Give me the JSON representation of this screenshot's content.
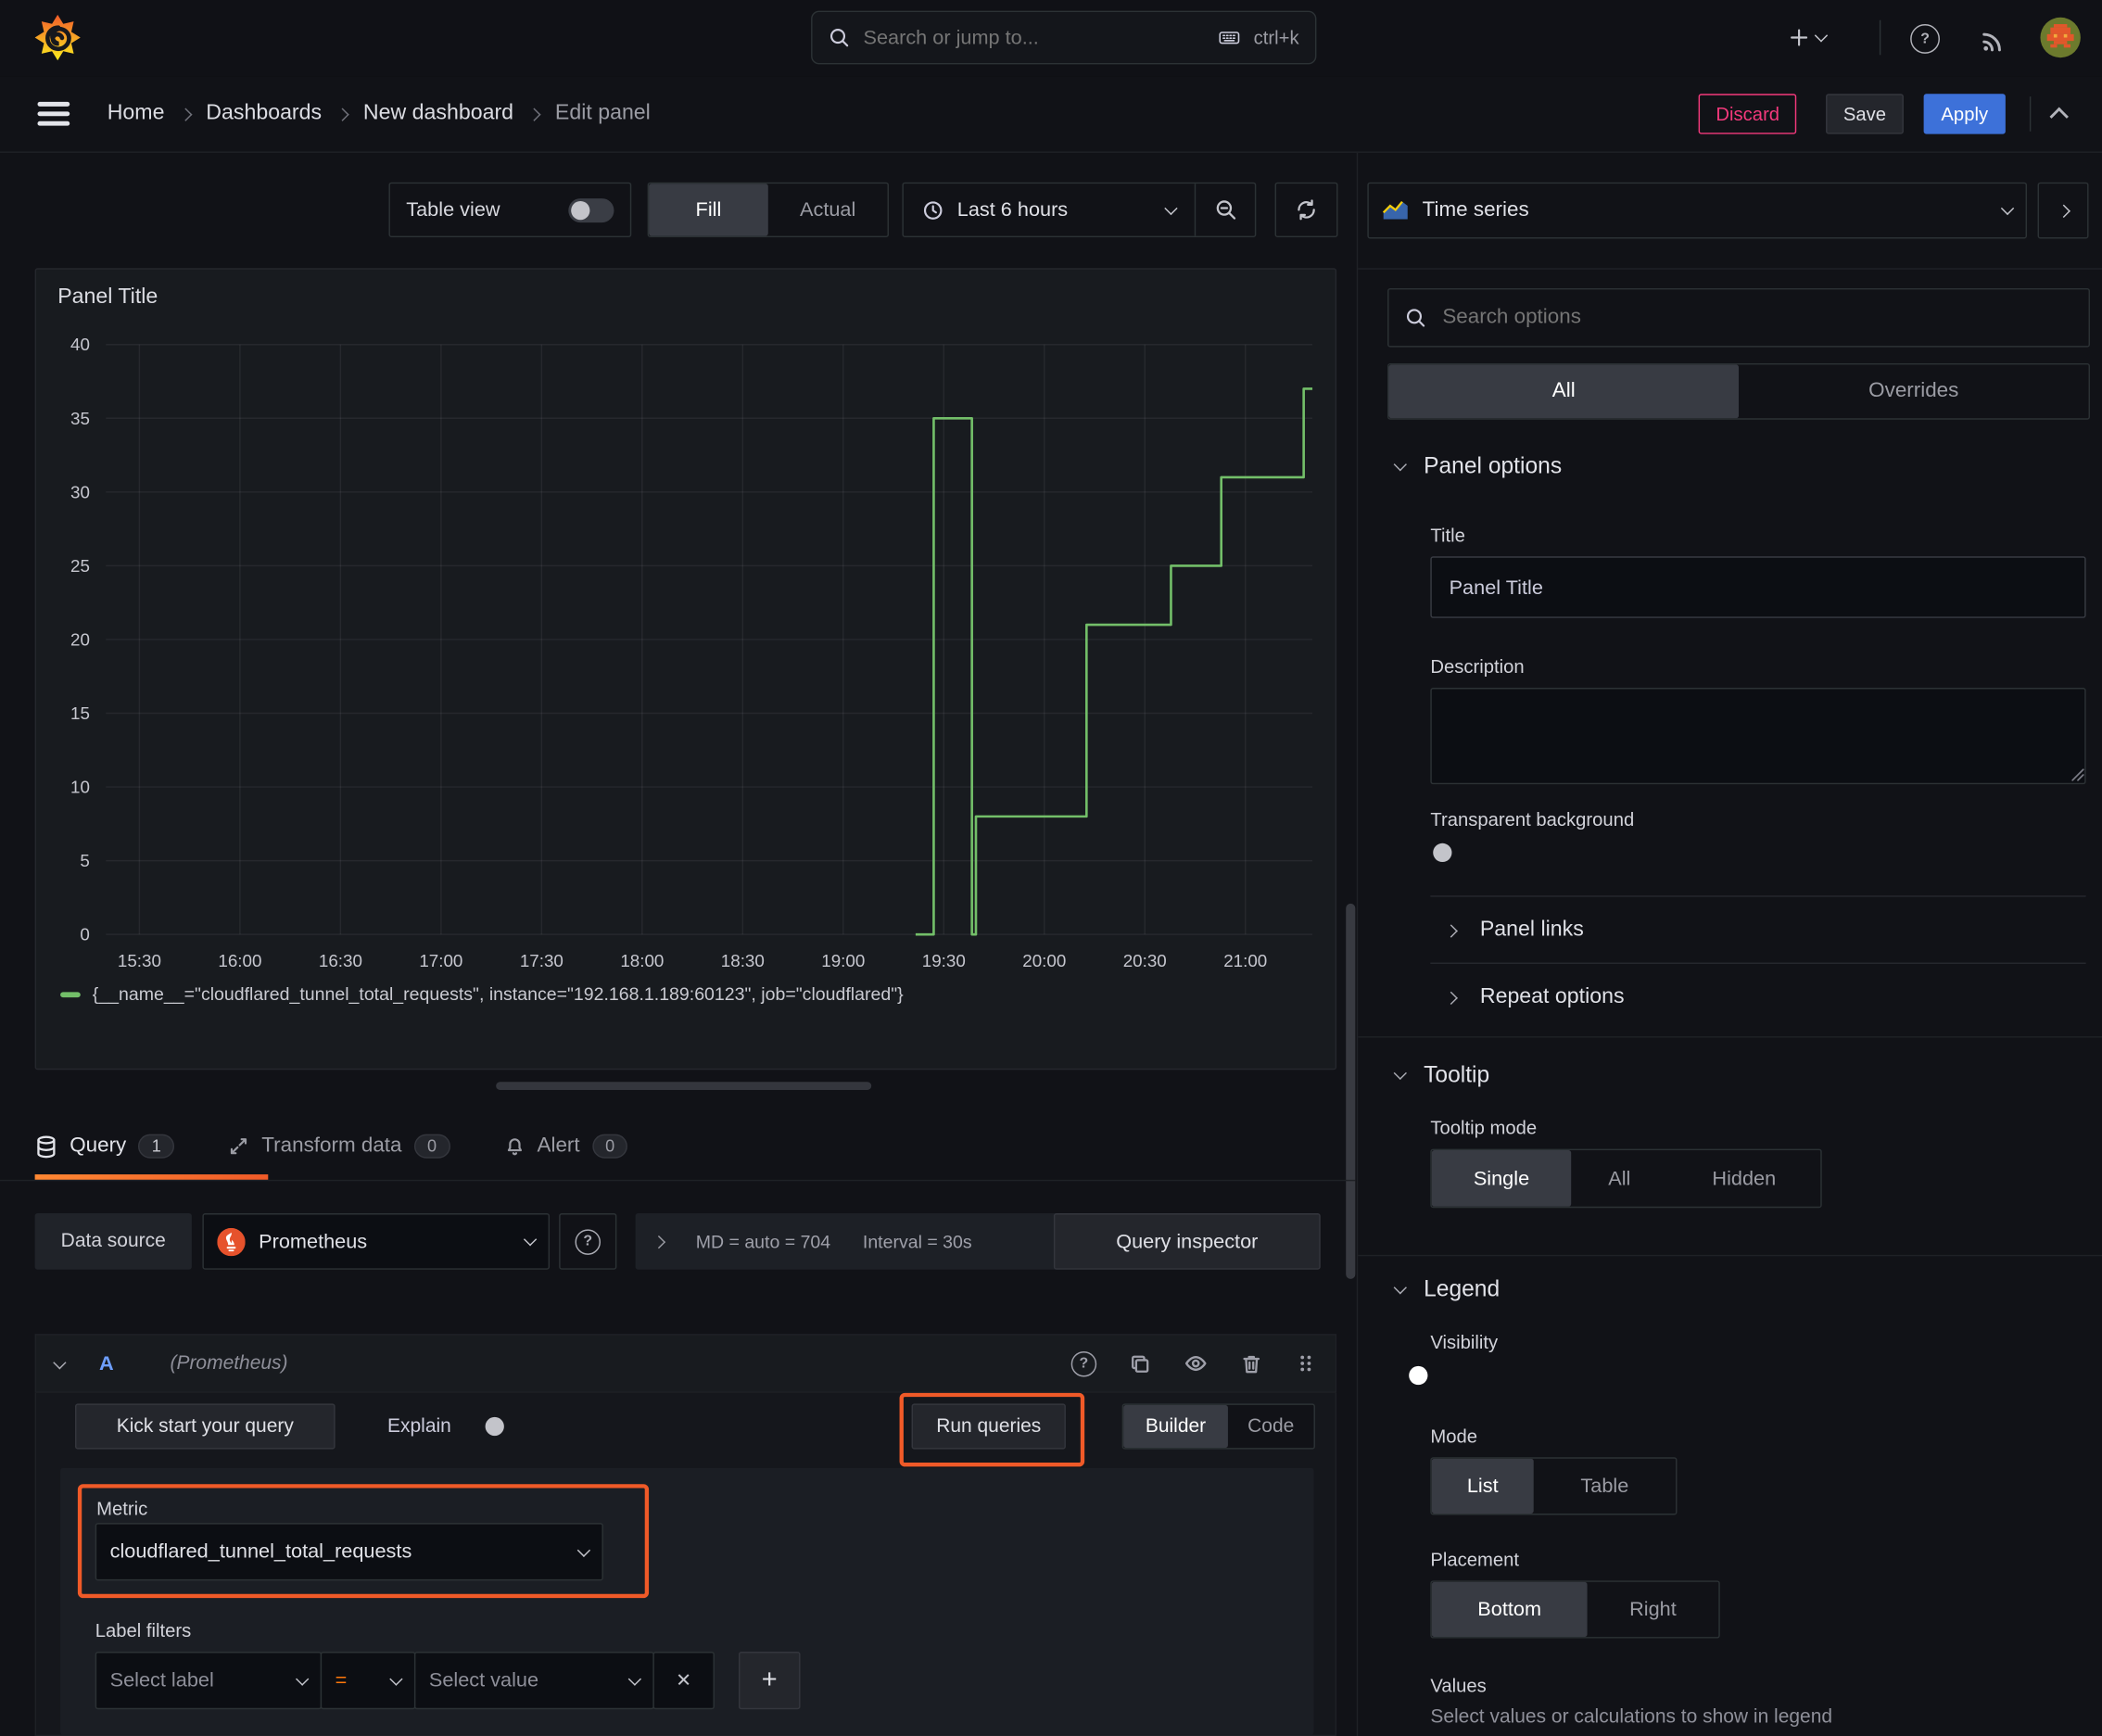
{
  "icons": {
    "question": "?",
    "plus": "+",
    "close": "✕"
  },
  "topbar": {
    "search_placeholder": "Search or jump to...",
    "shortcut": "ctrl+k"
  },
  "nav": {
    "breadcrumbs": [
      {
        "label": "Home"
      },
      {
        "label": "Dashboards"
      },
      {
        "label": "New dashboard"
      },
      {
        "label": "Edit panel"
      }
    ],
    "discard": "Discard",
    "save": "Save",
    "apply": "Apply"
  },
  "toolbar": {
    "table_view": "Table view",
    "fill": "Fill",
    "actual": "Actual",
    "time_range": "Last 6 hours"
  },
  "panel": {
    "title": "Panel Title",
    "legend": "{__name__=\"cloudflared_tunnel_total_requests\", instance=\"192.168.1.189:60123\", job=\"cloudflared\"}"
  },
  "chart_data": {
    "type": "line",
    "title": "Panel Title",
    "x_domain_hours": [
      15.3333,
      21.3333
    ],
    "y_domain": [
      0,
      40
    ],
    "y_ticks": [
      0,
      5,
      10,
      15,
      20,
      25,
      30,
      35,
      40
    ],
    "x_ticks": [
      {
        "t": 15.5,
        "label": "15:30"
      },
      {
        "t": 16,
        "label": "16:00"
      },
      {
        "t": 16.5,
        "label": "16:30"
      },
      {
        "t": 17,
        "label": "17:00"
      },
      {
        "t": 17.5,
        "label": "17:30"
      },
      {
        "t": 18,
        "label": "18:00"
      },
      {
        "t": 18.5,
        "label": "18:30"
      },
      {
        "t": 19,
        "label": "19:00"
      },
      {
        "t": 19.5,
        "label": "19:30"
      },
      {
        "t": 20,
        "label": "20:00"
      },
      {
        "t": 20.5,
        "label": "20:30"
      },
      {
        "t": 21,
        "label": "21:00"
      }
    ],
    "grid": true,
    "legend_position": "bottom",
    "series": [
      {
        "name": "{__name__=\"cloudflared_tunnel_total_requests\", instance=\"192.168.1.189:60123\", job=\"cloudflared\"}",
        "color": "#73bf69",
        "line_style": "step",
        "points": [
          [
            19.36,
            0
          ],
          [
            19.45,
            0
          ],
          [
            19.45,
            35
          ],
          [
            19.64,
            35
          ],
          [
            19.64,
            0
          ],
          [
            19.66,
            0
          ],
          [
            19.66,
            8
          ],
          [
            20.21,
            8
          ],
          [
            20.21,
            21
          ],
          [
            20.63,
            21
          ],
          [
            20.63,
            25
          ],
          [
            20.88,
            25
          ],
          [
            20.88,
            31
          ],
          [
            21.29,
            31
          ],
          [
            21.29,
            37
          ],
          [
            21.3333,
            37
          ]
        ]
      }
    ]
  },
  "tabs": {
    "query": "Query",
    "query_count": "1",
    "transform": "Transform data",
    "transform_count": "0",
    "alert": "Alert",
    "alert_count": "0"
  },
  "query": {
    "datasource_label": "Data source",
    "datasource": "Prometheus",
    "stats": "MD = auto = 704",
    "interval": "Interval = 30s",
    "inspector": "Query inspector",
    "ref_id": "A",
    "ref_ds": "(Prometheus)",
    "kickstart": "Kick start your query",
    "explain": "Explain",
    "run": "Run queries",
    "builder": "Builder",
    "code": "Code",
    "metric_label": "Metric",
    "metric_value": "cloudflared_tunnel_total_requests",
    "label_filters": "Label filters",
    "select_label": "Select label",
    "operator": "=",
    "select_value": "Select value"
  },
  "options": {
    "visualization": "Time series",
    "search_placeholder": "Search options",
    "tab_all": "All",
    "tab_overrides": "Overrides",
    "panel_options": "Panel options",
    "title_label": "Title",
    "title_value": "Panel Title",
    "description_label": "Description",
    "transparent_label": "Transparent background",
    "panel_links": "Panel links",
    "repeat_options": "Repeat options",
    "tooltip": "Tooltip",
    "tooltip_mode": "Tooltip mode",
    "tooltip_single": "Single",
    "tooltip_all": "All",
    "tooltip_hidden": "Hidden",
    "legend": "Legend",
    "visibility": "Visibility",
    "mode": "Mode",
    "mode_list": "List",
    "mode_table": "Table",
    "placement": "Placement",
    "placement_bottom": "Bottom",
    "placement_right": "Right",
    "values_label": "Values",
    "values_hint": "Select values or calculations to show in legend"
  },
  "colors": {
    "accent_orange": "#ff780a",
    "highlight_box": "#f05a28",
    "series_green": "#73bf69",
    "primary_blue": "#3d71d9",
    "discard_pink": "#f4397c"
  }
}
